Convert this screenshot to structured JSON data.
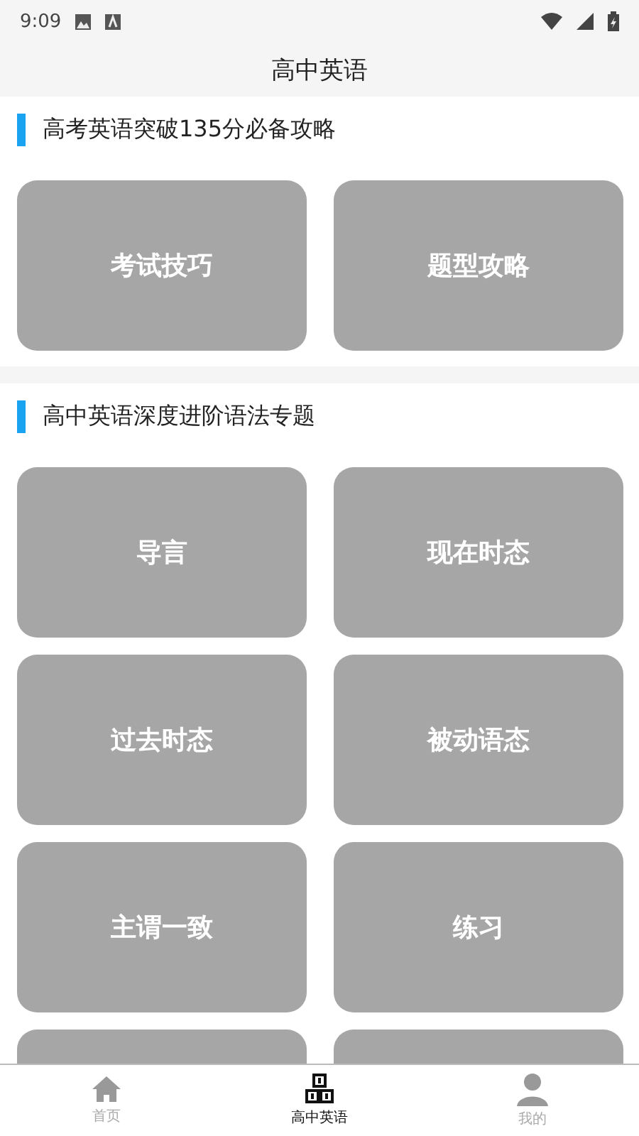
{
  "status_bar": {
    "time": "9:09"
  },
  "title": "高中英语",
  "sections": [
    {
      "heading": "高考英语突破135分必备攻略",
      "cards": [
        {
          "kind": "label",
          "label": "考试技巧"
        },
        {
          "kind": "label",
          "label": "题型攻略"
        }
      ]
    },
    {
      "heading": "高中英语深度进阶语法专题",
      "cards": [
        {
          "kind": "label",
          "label": "导言"
        },
        {
          "kind": "label",
          "label": "现在时态"
        },
        {
          "kind": "label",
          "label": "过去时态"
        },
        {
          "kind": "label",
          "label": "被动语态"
        },
        {
          "kind": "label",
          "label": "主谓一致"
        },
        {
          "kind": "label",
          "label": "练习"
        },
        {
          "kind": "cut"
        },
        {
          "kind": "cut"
        }
      ]
    }
  ],
  "tabs": [
    {
      "label": "首页",
      "kind": "home",
      "selected": false
    },
    {
      "label": "高中英语",
      "kind": "blocks",
      "selected": true
    },
    {
      "label": "我的",
      "kind": "person",
      "selected": false
    }
  ]
}
